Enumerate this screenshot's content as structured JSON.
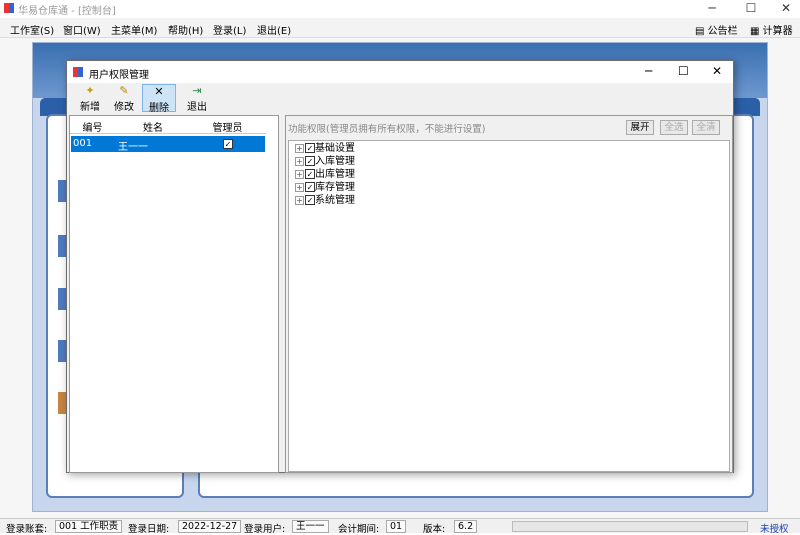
{
  "window": {
    "title": "华易仓库通 - [控制台]"
  },
  "menu": {
    "items": [
      "工作室(S)",
      "窗口(W)",
      "主菜单(M)",
      "帮助(H)",
      "登录(L)",
      "退出(E)"
    ],
    "right": [
      "公告栏",
      "计算器"
    ]
  },
  "dialog": {
    "title": "用户权限管理",
    "toolbar": [
      "新增",
      "修改",
      "删除",
      "退出"
    ],
    "grid": {
      "columns": [
        "编号",
        "姓名",
        "管理员"
      ],
      "rows": [
        {
          "id": "001",
          "name": "王一一",
          "admin": true
        }
      ]
    },
    "perm": {
      "label": "功能权限(管理员拥有所有权限，不能进行设置)",
      "buttons": [
        "展开",
        "全选",
        "全清"
      ],
      "tree": [
        "基础设置",
        "入库管理",
        "出库管理",
        "库存管理",
        "系统管理"
      ]
    }
  },
  "status": {
    "account_label": "登录账套:",
    "account": "001 工作职责",
    "date_label": "登录日期:",
    "date": "2022-12-27",
    "user_label": "登录用户:",
    "user": "王一一",
    "period_label": "会计期间:",
    "period": "01",
    "version_label": "版本:",
    "version": "6.2",
    "license": "未授权"
  }
}
